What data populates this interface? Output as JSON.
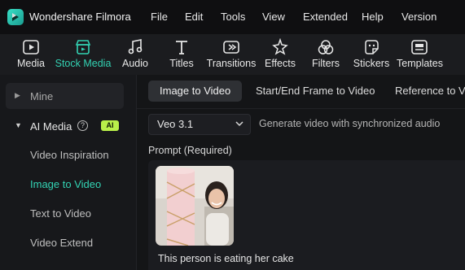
{
  "app": {
    "title": "Wondershare Filmora"
  },
  "menu": [
    "File",
    "Edit",
    "Tools",
    "View",
    "Extended",
    "Help",
    "Version"
  ],
  "toolbar": {
    "items": [
      {
        "label": "Media",
        "icon": "media-icon"
      },
      {
        "label": "Stock Media",
        "icon": "stock-media-icon",
        "active": true
      },
      {
        "label": "Audio",
        "icon": "audio-icon"
      },
      {
        "label": "Titles",
        "icon": "titles-icon"
      },
      {
        "label": "Transitions",
        "icon": "transitions-icon"
      },
      {
        "label": "Effects",
        "icon": "effects-icon"
      },
      {
        "label": "Filters",
        "icon": "filters-icon"
      },
      {
        "label": "Stickers",
        "icon": "stickers-icon"
      },
      {
        "label": "Templates",
        "icon": "templates-icon"
      }
    ]
  },
  "sidebar": {
    "mine_label": "Mine",
    "ai_media_label": "AI Media",
    "ai_badge": "AI",
    "ai_items": [
      "Video Inspiration",
      "Image to Video",
      "Text to Video",
      "Video Extend"
    ],
    "active_item": "Image to Video"
  },
  "main": {
    "tabs": [
      "Image to Video",
      "Start/End Frame to Video",
      "Reference to Vid"
    ],
    "active_tab": "Image to Video",
    "model": {
      "value": "Veo 3.1",
      "description": "Generate video with synchronized audio"
    },
    "prompt": {
      "label": "Prompt (Required)",
      "text": "This person is eating her cake"
    }
  },
  "colors": {
    "accent": "#33d3b4",
    "ai_badge": "#b9f04a",
    "background": "#141517"
  }
}
